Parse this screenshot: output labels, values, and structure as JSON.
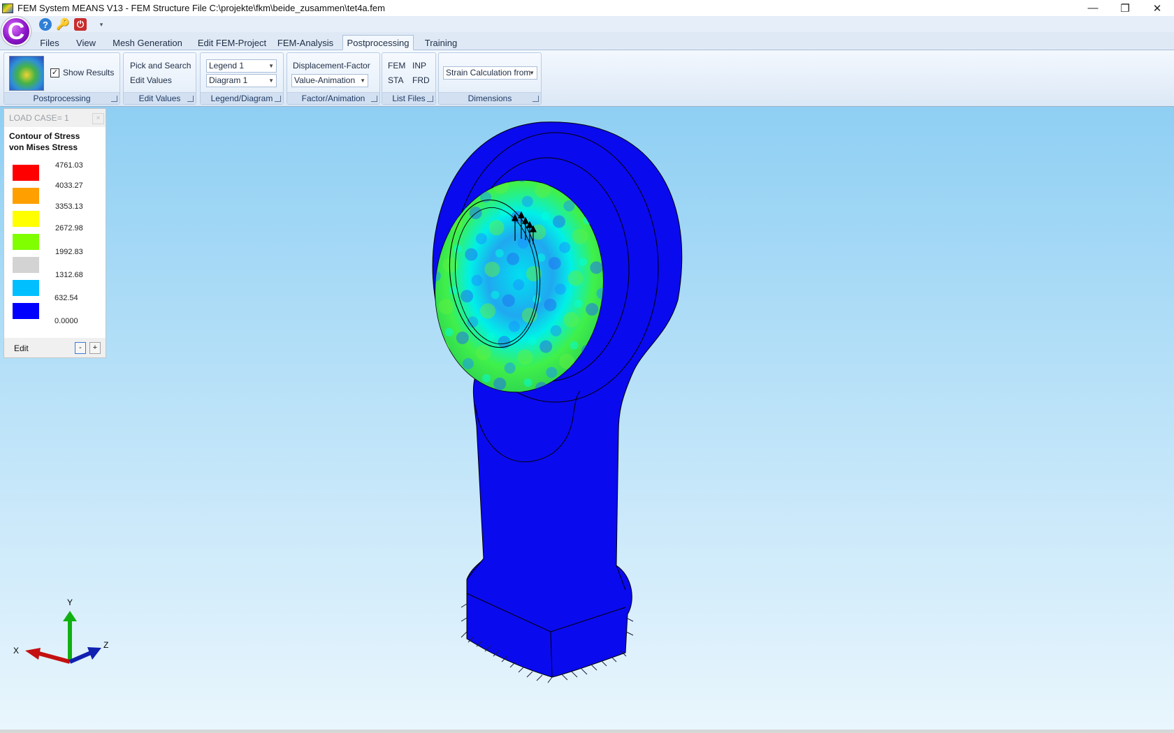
{
  "window": {
    "title": "FEM System MEANS V13 - FEM Structure File C:\\projekte\\fkm\\beide_zusammen\\tet4a.fem",
    "minimize": "—",
    "maximize": "❐",
    "close": "✕"
  },
  "quick_access": {
    "logo": "C",
    "help": "?",
    "key": "🔑",
    "power": "⏻",
    "dropdown": "▾"
  },
  "tabs": [
    {
      "label": "Files"
    },
    {
      "label": "View"
    },
    {
      "label": "Mesh Generation"
    },
    {
      "label": "Edit FEM-Project"
    },
    {
      "label": "FEM-Analysis"
    },
    {
      "label": "Postprocessing",
      "active": true
    },
    {
      "label": "Training"
    }
  ],
  "ribbon": {
    "postprocessing": {
      "show_results": "Show Results",
      "checked": true,
      "check_mark": "✓",
      "group_label": "Postprocessing"
    },
    "edit_values": {
      "pick_and_search": "Pick and Search",
      "edit_values": "Edit Values",
      "group_label": "Edit Values"
    },
    "legend_diagram": {
      "legend_select": "Legend 1",
      "diagram_select": "Diagram 1",
      "group_label": "Legend/Diagram"
    },
    "factor_animation": {
      "displacement_factor": "Displacement-Factor",
      "animation_select": "Value-Animation",
      "group_label": "Factor/Animation"
    },
    "list_files": {
      "fem": "FEM",
      "inp": "INP",
      "sta": "STA",
      "frd": "FRD",
      "group_label": "List Files"
    },
    "dimensions": {
      "strain_select": "Strain Calculation from",
      "group_label": "Dimensions"
    }
  },
  "legend_panel": {
    "header": "LOAD CASE=  1",
    "close": "×",
    "title_line1": "Contour of Stress",
    "title_line2": "von Mises Stress",
    "levels": [
      {
        "value": "4761.03",
        "color": "#ff0000"
      },
      {
        "value": "4033.27",
        "color": "#ffa000"
      },
      {
        "value": "3353.13",
        "color": "#ffff00"
      },
      {
        "value": "2672.98",
        "color": "#80ff00"
      },
      {
        "value": "1992.83",
        "color": "#d3d3d3"
      },
      {
        "value": "1312.68",
        "color": "#00bfff"
      },
      {
        "value": "632.54",
        "color": "#0000ff"
      }
    ],
    "bottom_value": "0.0000",
    "edit_label": "Edit",
    "minus": "-",
    "plus": "+"
  },
  "axes": {
    "x": "X",
    "y": "Y",
    "z": "Z"
  },
  "colors": {
    "mesh_blue": "#0a0aee",
    "bore_cyan": "#00e8f0",
    "bore_green": "#40f040"
  }
}
